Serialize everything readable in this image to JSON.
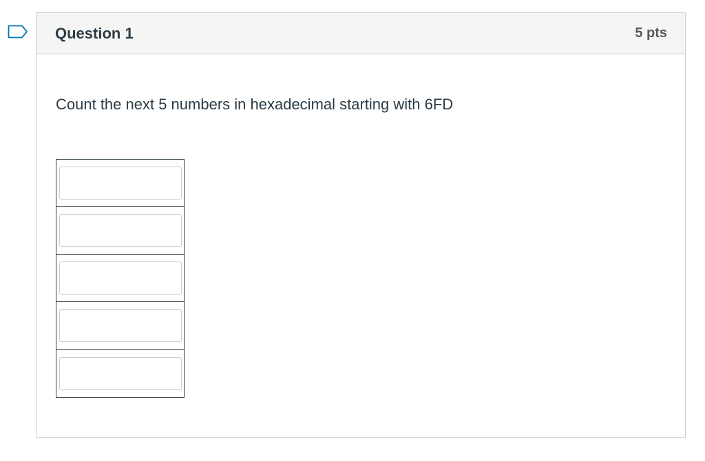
{
  "question": {
    "title": "Question 1",
    "points": "5 pts",
    "text": "Count the next 5 numbers in hexadecimal starting with 6FD",
    "flag_icon": "bookmark-flag-icon",
    "answers": [
      {
        "value": ""
      },
      {
        "value": ""
      },
      {
        "value": ""
      },
      {
        "value": ""
      },
      {
        "value": ""
      }
    ]
  },
  "colors": {
    "border": "#c7cdd1",
    "header_bg": "#f5f5f5",
    "text": "#2d3b45",
    "flag": "#0374b5"
  }
}
